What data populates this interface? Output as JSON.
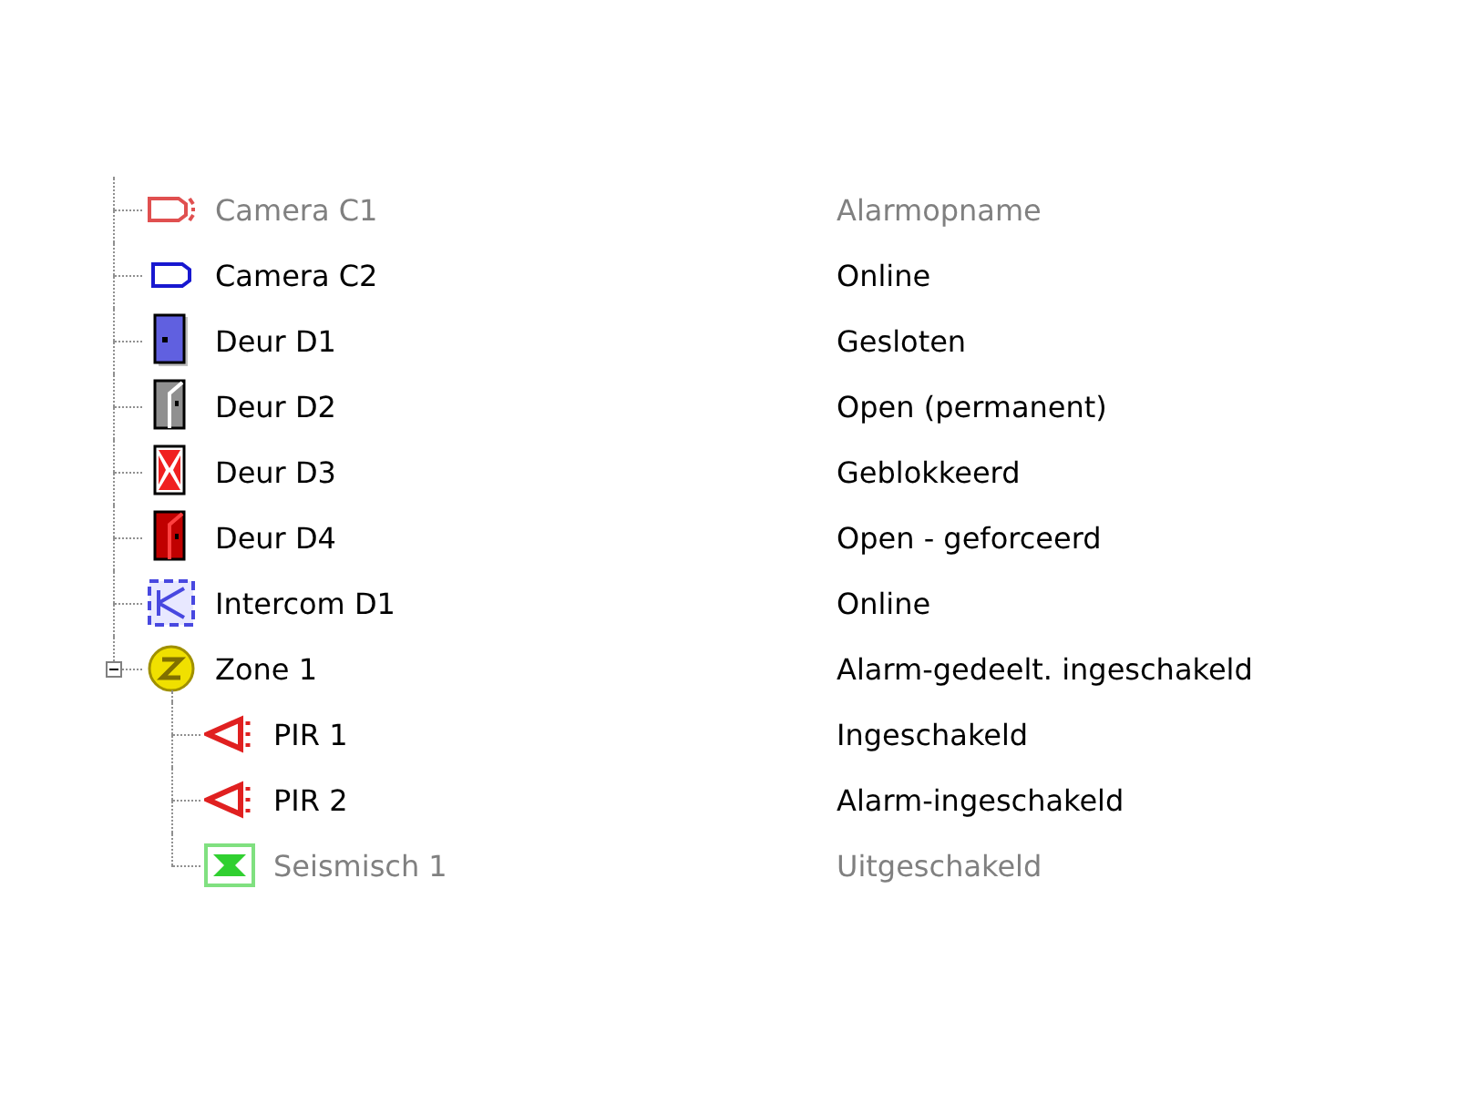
{
  "tree": {
    "items": [
      {
        "kind": "camera-alarm",
        "name": "Camera C1",
        "status": "Alarmopname",
        "disabled": true
      },
      {
        "kind": "camera",
        "name": "Camera C2",
        "status": "Online",
        "disabled": false
      },
      {
        "kind": "door-closed",
        "name": "Deur D1",
        "status": "Gesloten",
        "disabled": false
      },
      {
        "kind": "door-open",
        "name": "Deur D2",
        "status": "Open (permanent)",
        "disabled": false
      },
      {
        "kind": "door-blocked",
        "name": "Deur D3",
        "status": "Geblokkeerd",
        "disabled": false
      },
      {
        "kind": "door-forced",
        "name": "Deur D4",
        "status": "Open - geforceerd",
        "disabled": false
      },
      {
        "kind": "intercom",
        "name": "Intercom D1",
        "status": "Online",
        "disabled": false
      },
      {
        "kind": "zone",
        "name": "Zone 1",
        "status": "Alarm-gedeelt. ingeschakeld",
        "disabled": false,
        "expanded": true,
        "children": [
          {
            "kind": "pir",
            "name": "PIR 1",
            "status": "Ingeschakeld",
            "disabled": false
          },
          {
            "kind": "pir",
            "name": "PIR 2",
            "status": "Alarm-ingeschakeld",
            "disabled": false
          },
          {
            "kind": "seismic",
            "name": "Seismisch 1",
            "status": "Uitgeschakeld",
            "disabled": true
          }
        ]
      }
    ]
  }
}
